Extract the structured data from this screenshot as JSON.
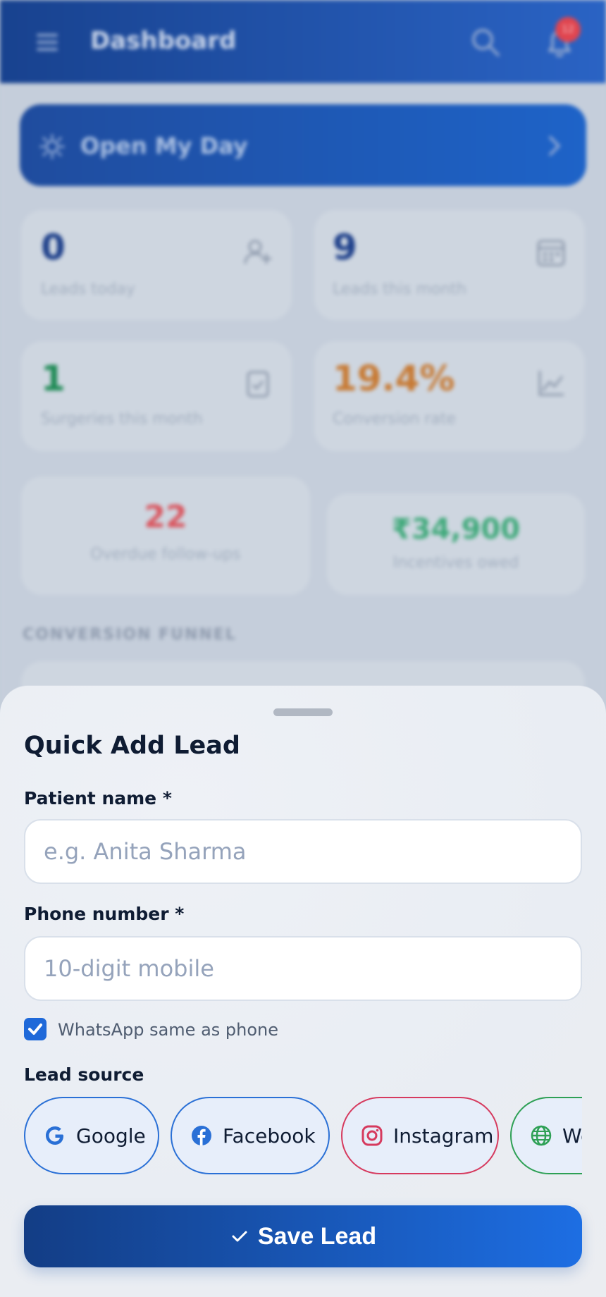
{
  "header": {
    "title": "Dashboard",
    "notification_count": "12",
    "icons": [
      "menu-icon",
      "search-icon",
      "bell-icon"
    ]
  },
  "my_day": {
    "label": "Open My Day"
  },
  "stats": [
    {
      "value": "0",
      "label": "Leads today",
      "icon": "user-plus-icon",
      "color": "#1d3f8a"
    },
    {
      "value": "9",
      "label": "Leads this month",
      "icon": "calendar-icon",
      "color": "#1d3f8a"
    },
    {
      "value": "1",
      "label": "Surgeries this month",
      "icon": "clipboard-check-icon",
      "color": "#1e8a55"
    },
    {
      "value": "19.4%",
      "label": "Conversion rate",
      "icon": "trend-chart-icon",
      "color": "#c77a34"
    }
  ],
  "overdue": {
    "value": "22",
    "label": "Overdue follow-ups",
    "color": "#d9565f"
  },
  "incentives": {
    "value": "₹34,900",
    "label": "Incentives owed",
    "color": "#3fa97a"
  },
  "funnel": {
    "title": "CONVERSION FUNNEL"
  },
  "sheet": {
    "title": "Quick Add Lead",
    "patient_name": {
      "label": "Patient name *",
      "placeholder": "e.g. Anita Sharma",
      "value": ""
    },
    "phone": {
      "label": "Phone number *",
      "placeholder": "10-digit mobile",
      "value": ""
    },
    "whatsapp": {
      "label": "WhatsApp same as phone",
      "checked": true
    },
    "lead_source": {
      "label": "Lead source",
      "chips": [
        {
          "label": "Google",
          "icon": "google-icon",
          "color": "#2a70d6"
        },
        {
          "label": "Facebook",
          "icon": "facebook-icon",
          "color": "#2a70d6"
        },
        {
          "label": "Instagram",
          "icon": "instagram-icon",
          "color": "#d63a5e"
        },
        {
          "label": "Website",
          "icon": "globe-icon",
          "color": "#2ea055"
        }
      ]
    },
    "save_label": "Save Lead"
  }
}
